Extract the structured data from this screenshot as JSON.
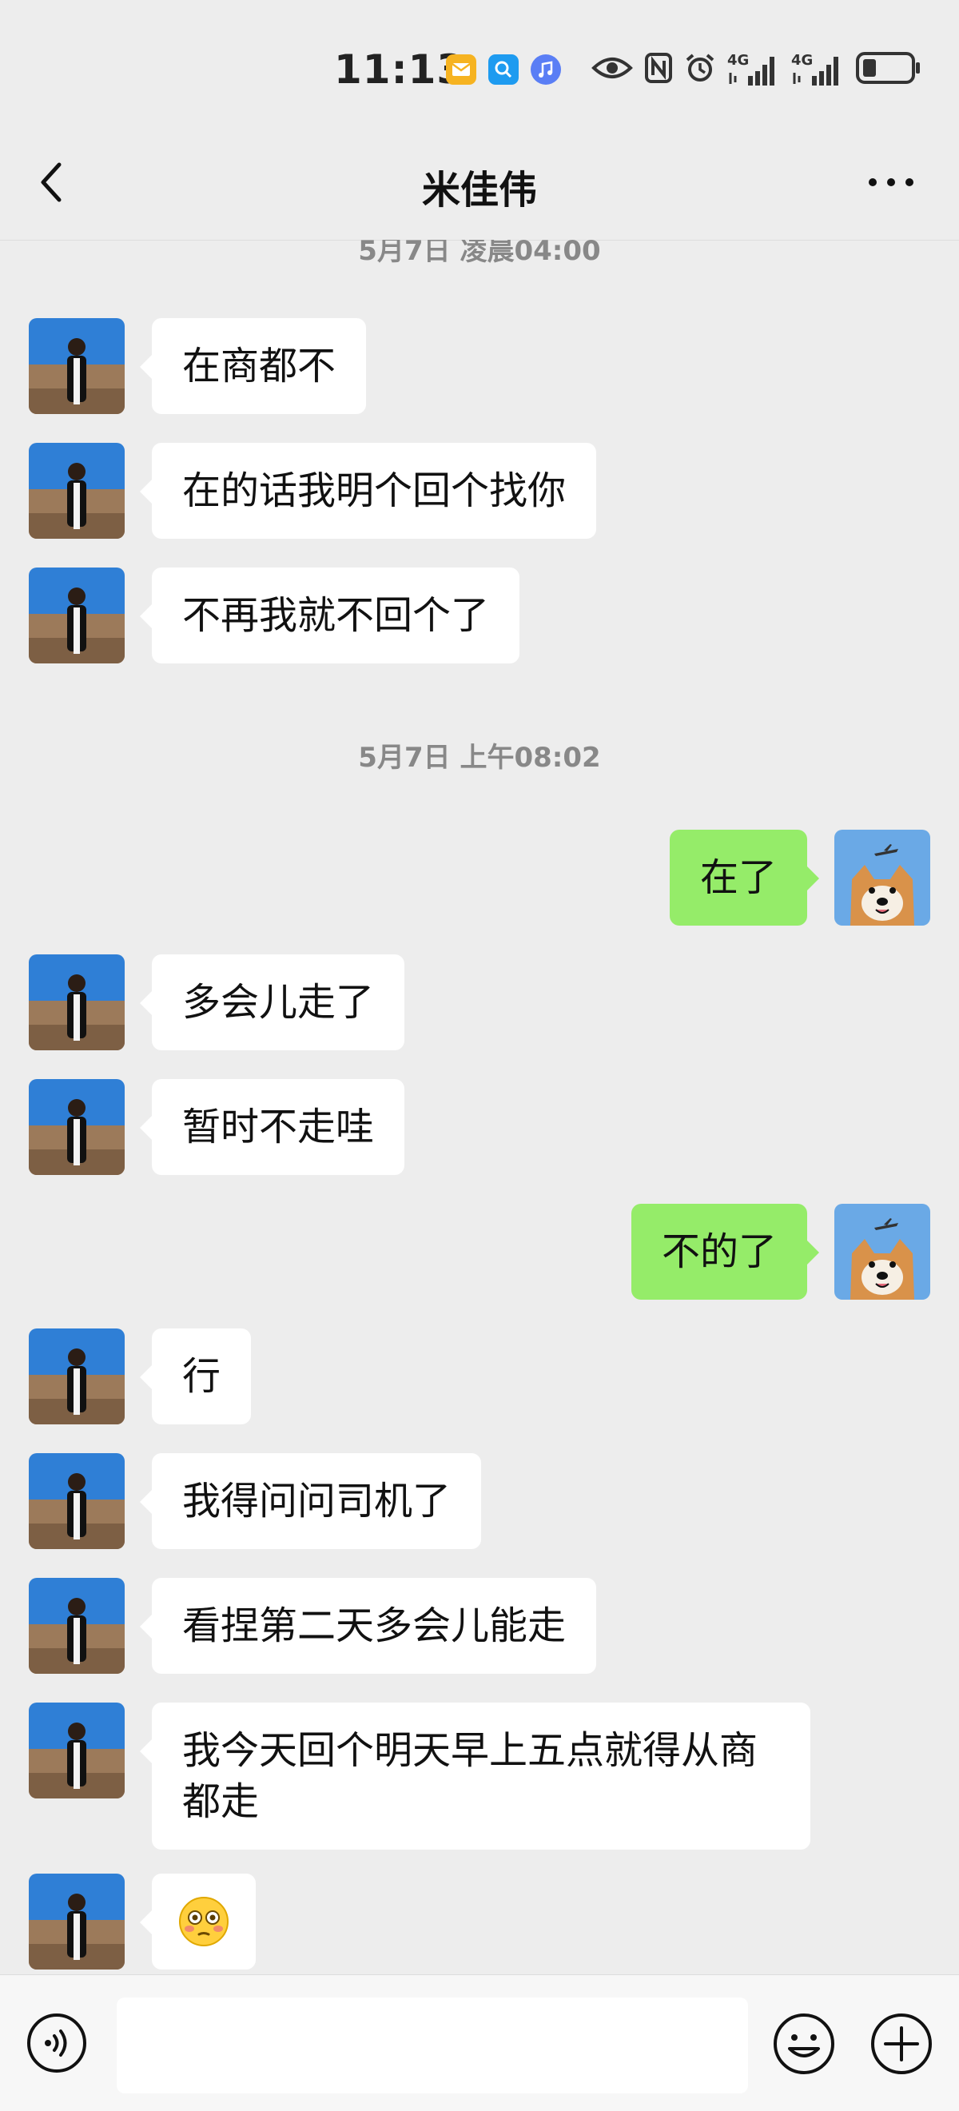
{
  "status_bar": {
    "time": "11:13",
    "net_label_1": "4G",
    "net_label_2": "4G",
    "apps": [
      "mail-app-icon",
      "search-app-icon",
      "music-app-icon"
    ],
    "colors": {
      "mail": "#f6b321",
      "search": "#1e9bf0",
      "music": "#5a7ef5"
    }
  },
  "header": {
    "title": "米佳伟"
  },
  "messages": [
    {
      "kind": "time",
      "text": "5月7日 凌晨04:00"
    },
    {
      "kind": "msg",
      "side": "in",
      "text": "在商都不"
    },
    {
      "kind": "msg",
      "side": "in",
      "text": "在的话我明个回个找你"
    },
    {
      "kind": "msg",
      "side": "in",
      "text": "不再我就不回个了"
    },
    {
      "kind": "time",
      "text": "5月7日 上午08:02"
    },
    {
      "kind": "msg",
      "side": "out",
      "text": "在了"
    },
    {
      "kind": "msg",
      "side": "in",
      "text": "多会儿走了"
    },
    {
      "kind": "msg",
      "side": "in",
      "text": "暂时不走哇"
    },
    {
      "kind": "msg",
      "side": "out",
      "text": "不的了"
    },
    {
      "kind": "msg",
      "side": "in",
      "text": "行"
    },
    {
      "kind": "msg",
      "side": "in",
      "text": "我得问问司机了"
    },
    {
      "kind": "msg",
      "side": "in",
      "text": "看捏第二天多会儿能走"
    },
    {
      "kind": "msg",
      "side": "in",
      "text": "我今天回个明天早上五点就得从商都走"
    },
    {
      "kind": "msg",
      "side": "in",
      "emoji": "flushed-face-emoji",
      "text": ""
    }
  ],
  "input_bar": {
    "value": "",
    "placeholder": ""
  },
  "colors": {
    "bubble_out": "#95ec69",
    "bubble_in": "#ffffff",
    "background": "#ededed"
  }
}
